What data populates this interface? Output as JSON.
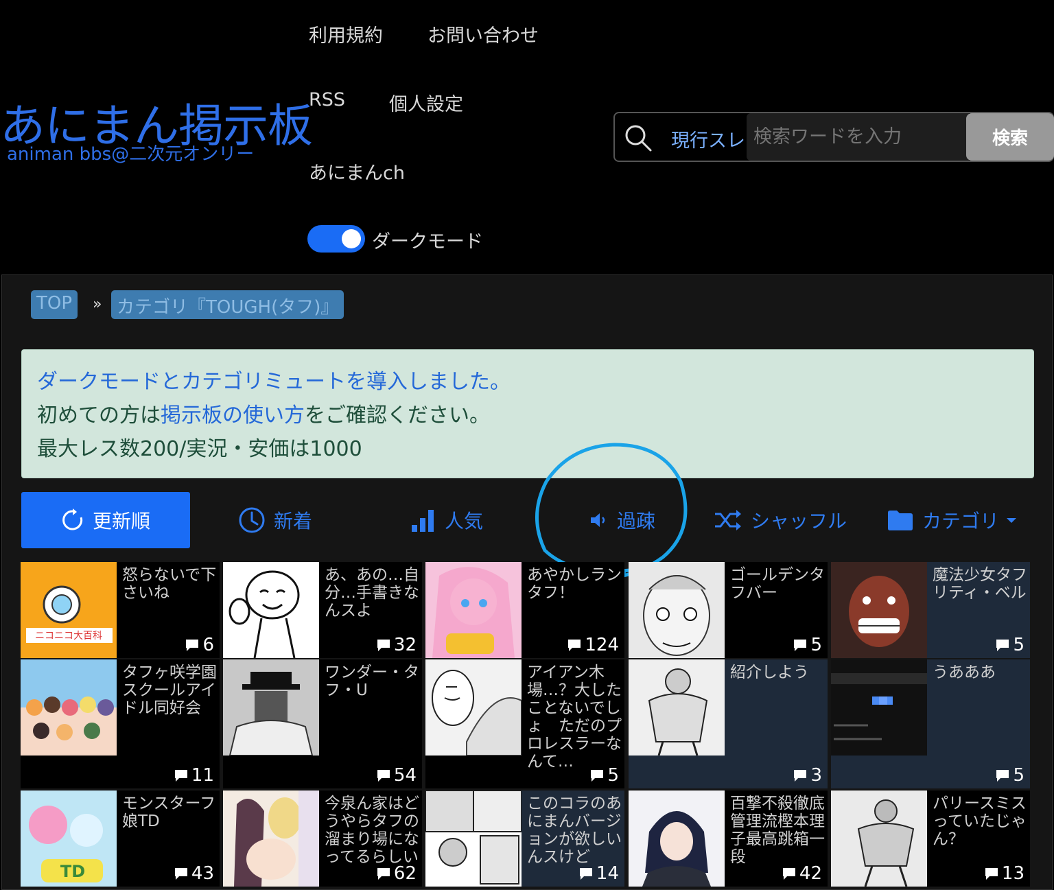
{
  "logo": {
    "title": "あにまん掲示板",
    "subtitle": "animan bbs@二次元オンリー"
  },
  "nav": {
    "terms": "利用規約",
    "contact": "お問い合わせ",
    "rss": "RSS",
    "settings": "個人設定",
    "animanch": "あにまんch",
    "dark_mode_label": "ダークモード"
  },
  "search": {
    "scope": "現行スレ",
    "placeholder": "検索ワードを入力",
    "button": "検索"
  },
  "breadcrumb": {
    "top": "TOP",
    "sep": "»",
    "category": "カテゴリ『TOUGH(タフ)』"
  },
  "notice": {
    "line1": "ダークモードとカテゴリミュートを導入しました。",
    "line2_pre": "初めての方は",
    "line2_link": "掲示板の使い方",
    "line2_post": "をご確認ください。",
    "line3": "最大レス数200/実況・安価は1000"
  },
  "tabs": {
    "update": "更新順",
    "new": "新着",
    "popular": "人気",
    "old": "過疎",
    "shuffle": "シャッフル",
    "category": "カテゴリ"
  },
  "colors": {
    "accent": "#1a6cf5",
    "link": "#2f7bf0",
    "annotation": "#1aa3e8"
  },
  "threads": [
    {
      "title": "怒らないで下さいね",
      "count": "6",
      "thumb": "nicopedia"
    },
    {
      "title": "あ、あの…自分…手書きなんスよ",
      "count": "32",
      "thumb": "sketch"
    },
    {
      "title": "あやかしランタフ！",
      "count": "124",
      "thumb": "anime-pink"
    },
    {
      "title": "ゴールデンタフバー",
      "count": "5",
      "thumb": "manga-face"
    },
    {
      "title": "魔法少女タフリティ・ベル",
      "count": "5",
      "thumb": "manga-red"
    },
    {
      "title": "タフヶ咲学園スクールアイドル同好会",
      "count": "11",
      "thumb": "anime-group"
    },
    {
      "title": "ワンダー・タフ・U",
      "count": "54",
      "thumb": "manga-hat"
    },
    {
      "title": "アイアン木場…？大したことないでしょ　ただのプロレスラーなんて…",
      "count": "5",
      "thumb": "manga-man"
    },
    {
      "title": "紹介しよう",
      "count": "3",
      "thumb": "manga-muscle"
    },
    {
      "title": "うあああ",
      "count": "5",
      "thumb": "screenshot"
    },
    {
      "title": "モンスターフ娘TD",
      "count": "43",
      "thumb": "anime-td"
    },
    {
      "title": "今泉ん家はどうやらタフの溜まり場になってるらしい",
      "count": "62",
      "thumb": "anime-girls"
    },
    {
      "title": "このコラのあにまんバージョンが欲しいんスけど",
      "count": "14",
      "thumb": "manga-panel"
    },
    {
      "title": "百撃不殺徹底管理流樫本理子最高跳箱一段",
      "count": "42",
      "thumb": "anime-suit"
    },
    {
      "title": "パリースミスっていたじゃん？",
      "count": "13",
      "thumb": "manga-fighter"
    }
  ]
}
